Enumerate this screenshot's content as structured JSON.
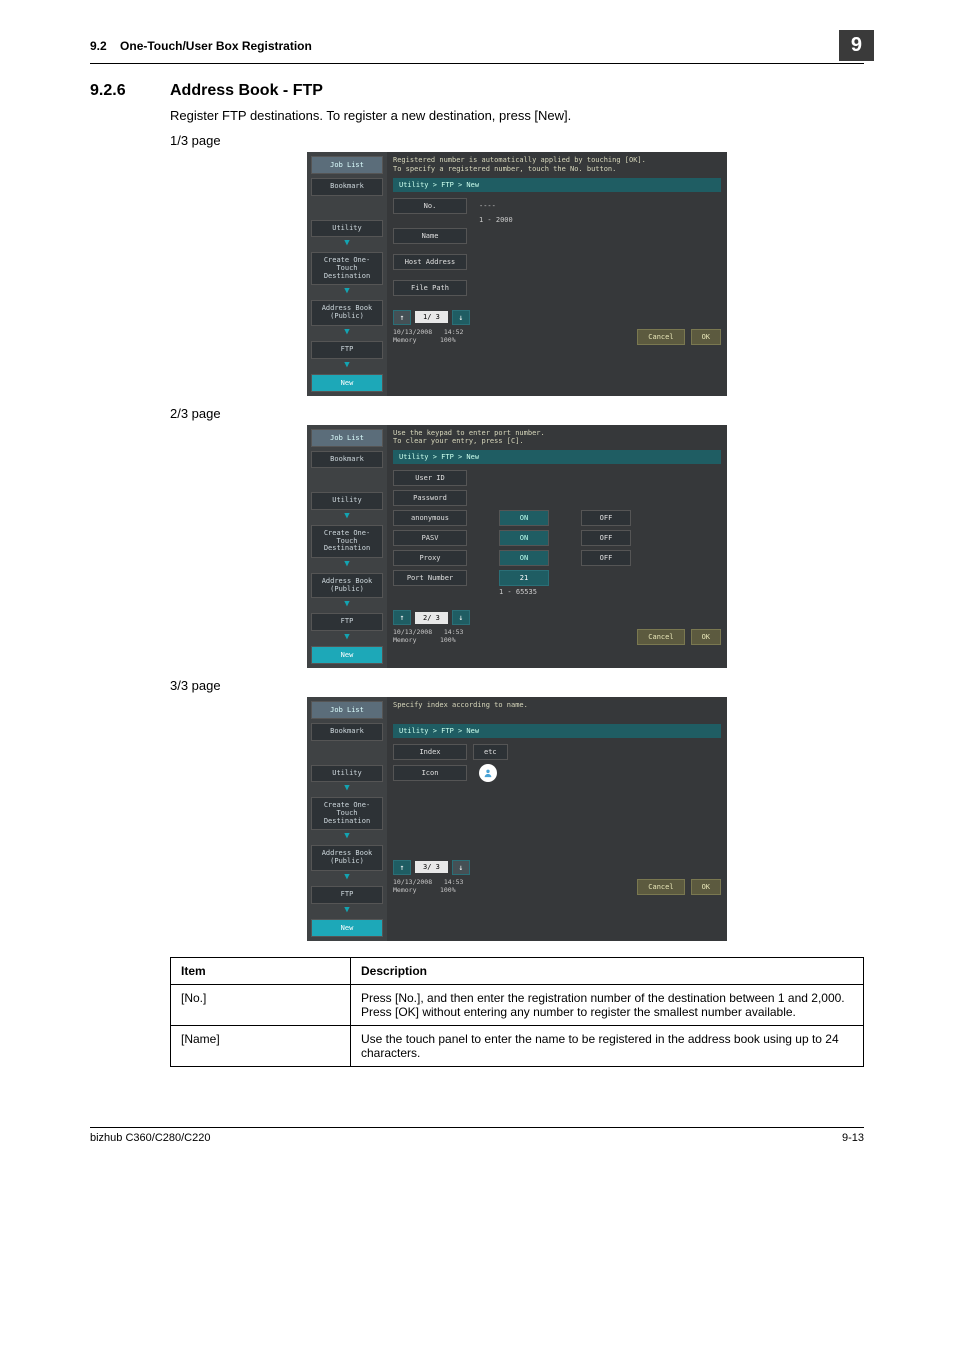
{
  "header": {
    "section_ref": "9.2",
    "section_name": "One-Touch/User Box Registration",
    "chapter": "9"
  },
  "section": {
    "number": "9.2.6",
    "title": "Address Book - FTP",
    "intro": "Register FTP destinations. To register a new destination, press [New].",
    "page_label_1": "1/3 page",
    "page_label_2": "2/3 page",
    "page_label_3": "3/3 page"
  },
  "side_nav": {
    "job_list": "Job List",
    "bookmark": "Bookmark",
    "utility": "Utility",
    "create": "Create One-Touch\nDestination",
    "address_book": "Address Book\n(Public)",
    "ftp": "FTP",
    "new_": "New"
  },
  "screen1": {
    "hint": "Registered number is automatically applied by touching [OK].\nTo specify a registered number, touch the No. button.",
    "path": "Utility > FTP > New",
    "no_label": "No.",
    "no_value": "----",
    "no_range": "1 - 2000",
    "name_label": "Name",
    "host_label": "Host Address",
    "file_label": "File Path",
    "pager": "1/ 3",
    "date": "10/13/2008",
    "time": "14:52",
    "mem_lbl": "Memory",
    "mem_pct": "100%",
    "cancel": "Cancel",
    "ok": "OK"
  },
  "screen2": {
    "hint": "Use the keypad to enter port number.\nTo clear your entry, press [C].",
    "path": "Utility > FTP > New",
    "user_id": "User ID",
    "password": "Password",
    "anonymous": "anonymous",
    "pasv": "PASV",
    "proxy": "Proxy",
    "port_label": "Port Number",
    "port_value": "21",
    "port_range": "1  -  65535",
    "on": "ON",
    "off": "OFF",
    "pager": "2/ 3",
    "date": "10/13/2008",
    "time": "14:53",
    "mem_lbl": "Memory",
    "mem_pct": "100%",
    "cancel": "Cancel",
    "ok": "OK"
  },
  "screen3": {
    "hint": "Specify index according to name.",
    "path": "Utility > FTP > New",
    "index": "Index",
    "etc": "etc",
    "icon": "Icon",
    "pager": "3/ 3",
    "date": "10/13/2008",
    "time": "14:53",
    "mem_lbl": "Memory",
    "mem_pct": "100%",
    "cancel": "Cancel",
    "ok": "OK"
  },
  "table": {
    "head_item": "Item",
    "head_desc": "Description",
    "rows": [
      {
        "item": "[No.]",
        "desc": "Press [No.], and then enter the registration number of the destination between 1 and 2,000. Press [OK] without entering any number to register the smallest number available."
      },
      {
        "item": "[Name]",
        "desc": "Use the touch panel to enter the name to be registered in the address book using up to 24 characters."
      }
    ]
  },
  "footer": {
    "model": "bizhub C360/C280/C220",
    "page": "9-13"
  }
}
